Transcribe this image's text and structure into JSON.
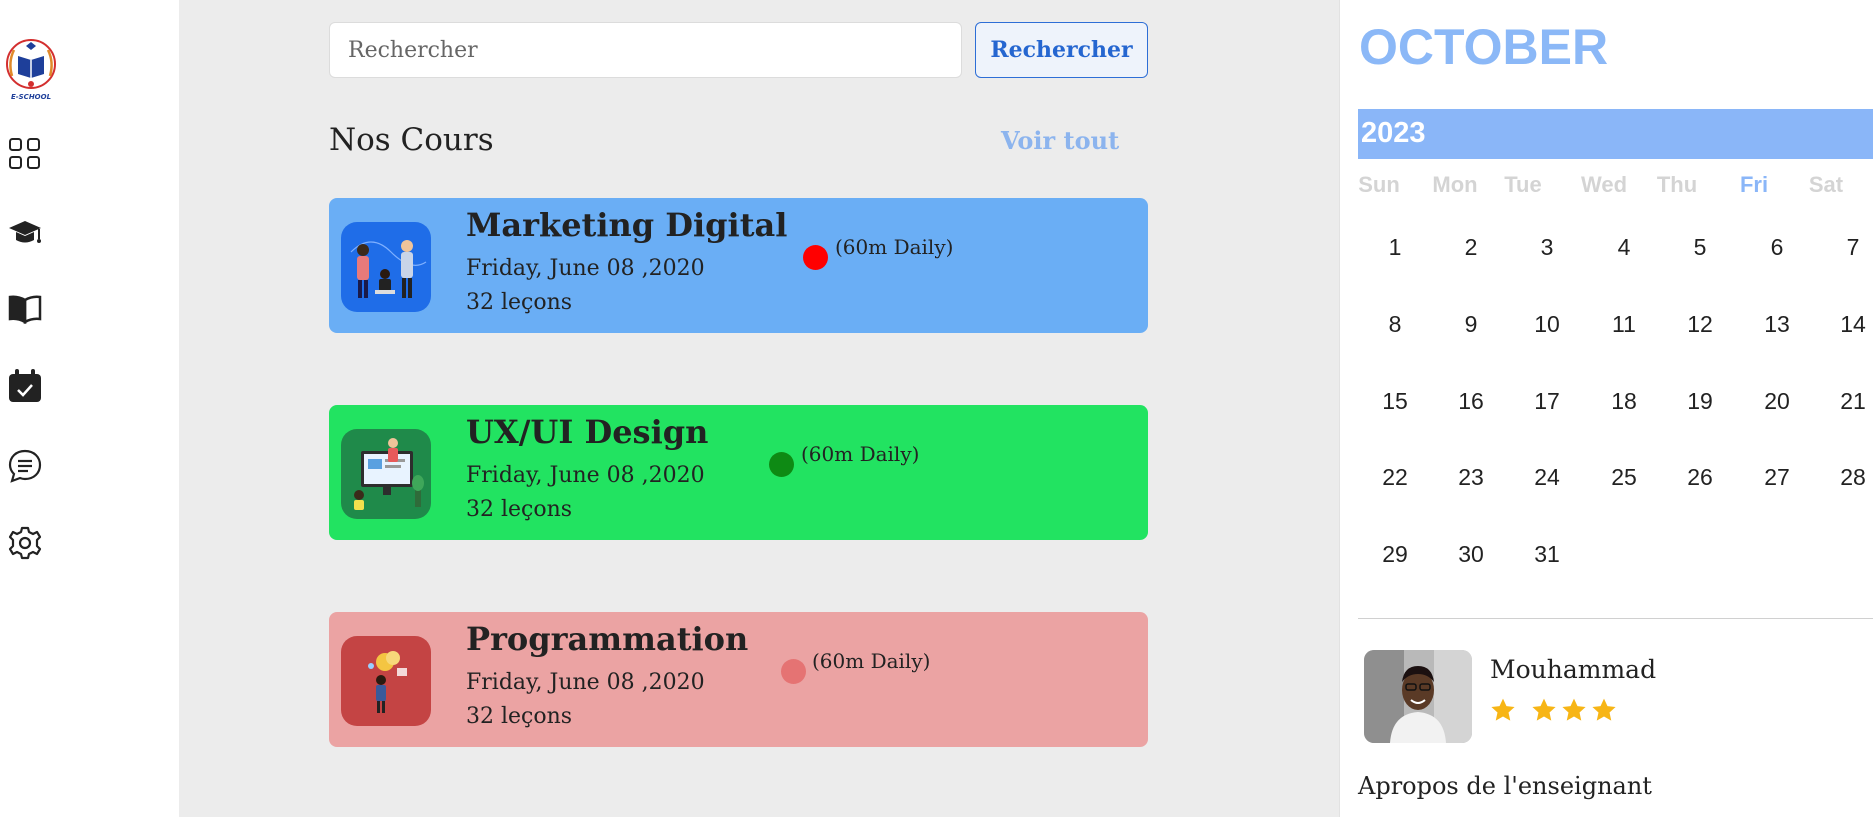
{
  "app": {
    "logo_text": "E-SCHOOL"
  },
  "sidebar": {
    "items": [
      {
        "name": "dashboard",
        "icon": "grid-icon"
      },
      {
        "name": "courses",
        "icon": "graduation-cap-icon"
      },
      {
        "name": "library",
        "icon": "book-icon"
      },
      {
        "name": "calendar",
        "icon": "calendar-check-icon"
      },
      {
        "name": "messages",
        "icon": "chat-icon"
      },
      {
        "name": "settings",
        "icon": "gear-icon"
      }
    ]
  },
  "search": {
    "placeholder": "Rechercher",
    "button_label": "Rechercher"
  },
  "courses_section": {
    "title": "Nos Cours",
    "see_all": "Voir tout",
    "items": [
      {
        "title": "Marketing Digital",
        "date": "Friday, June 08 ,2020",
        "lessons": "32 leçons",
        "duration": "(60m Daily)",
        "card_color": "#6aaef5",
        "dot_color": "#ff0000",
        "thumb_color": "#1f6de8"
      },
      {
        "title": "UX/UI Design",
        "date": "Friday, June 08 ,2020",
        "lessons": "32 leçons",
        "duration": "(60m Daily)",
        "card_color": "#22e361",
        "dot_color": "#0e8a14",
        "thumb_color": "#1f8a4a"
      },
      {
        "title": "Programmation",
        "date": "Friday, June 08 ,2020",
        "lessons": "32 leçons",
        "duration": "(60m Daily)",
        "card_color": "#eba3a3",
        "dot_color": "#e57373",
        "thumb_color": "#c44444"
      }
    ]
  },
  "calendar": {
    "month": "OCTOBER",
    "year": "2023",
    "weekdays": [
      "Sun",
      "Mon",
      "Tue",
      "Wed",
      "Thu",
      "Fri",
      "Sat"
    ],
    "active_weekday": "Fri",
    "accent_color": "#8ab6f8",
    "days": [
      [
        "1",
        "2",
        "3",
        "4",
        "5",
        "6",
        "7"
      ],
      [
        "8",
        "9",
        "10",
        "11",
        "12",
        "13",
        "14"
      ],
      [
        "15",
        "16",
        "17",
        "18",
        "19",
        "20",
        "21"
      ],
      [
        "22",
        "23",
        "24",
        "25",
        "26",
        "27",
        "28"
      ],
      [
        "29",
        "30",
        "31"
      ]
    ]
  },
  "teacher": {
    "name": "Mouhammad",
    "rating": 4,
    "about_title": "Apropos de l'enseignant",
    "star_color": "#f7b515"
  }
}
